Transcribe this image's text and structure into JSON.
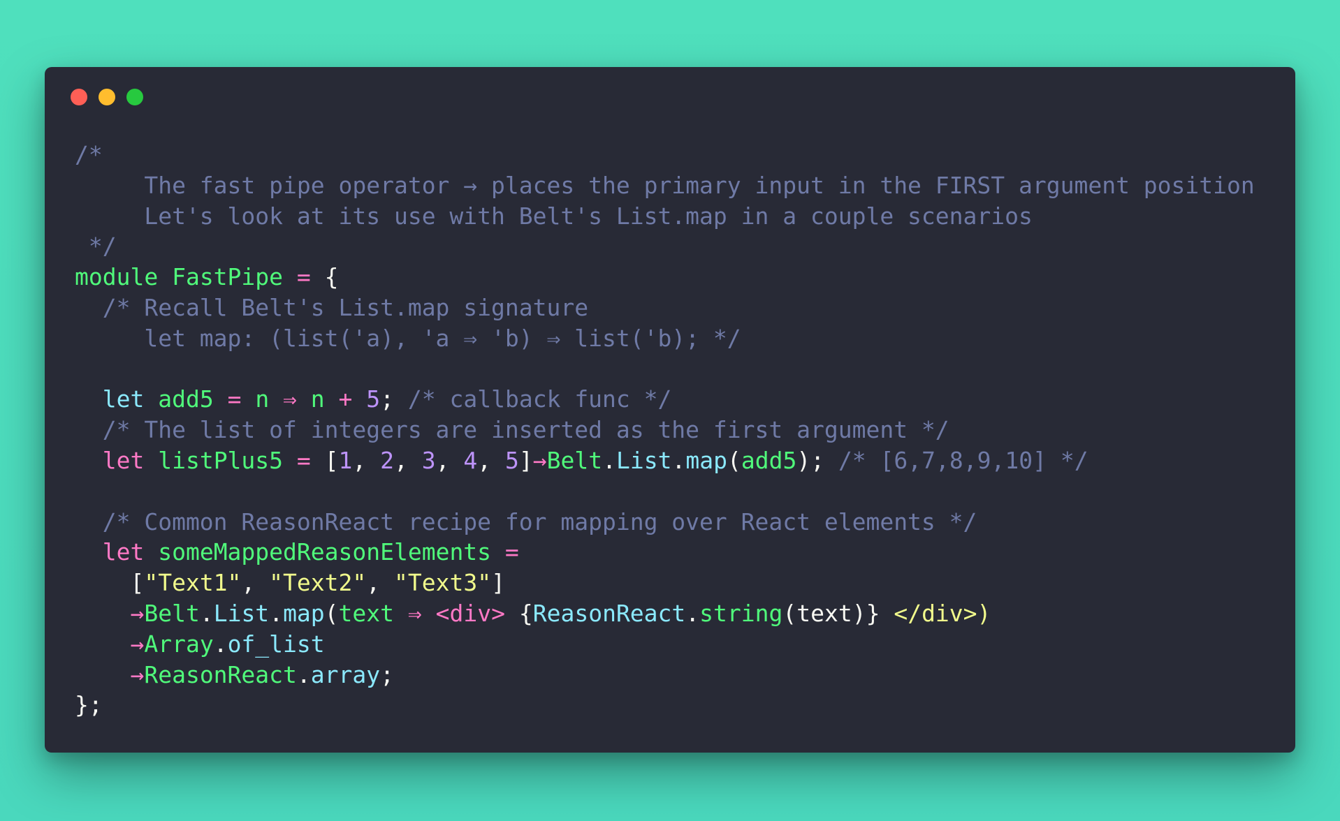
{
  "window": {
    "controls": {
      "close": "red-close",
      "minimize": "yellow-minimize",
      "zoom": "green-zoom"
    }
  },
  "code": {
    "lines": [
      [
        {
          "t": "/*",
          "c": "comment"
        }
      ],
      [
        {
          "t": "     The fast pipe operator → places the primary input in the FIRST argument position",
          "c": "comment"
        }
      ],
      [
        {
          "t": "     Let's look at its use with Belt's List.map in a couple scenarios",
          "c": "comment"
        }
      ],
      [
        {
          "t": " */",
          "c": "comment"
        }
      ],
      [
        {
          "t": "module ",
          "c": "module"
        },
        {
          "t": "FastPipe",
          "c": "name"
        },
        {
          "t": " = ",
          "c": "op"
        },
        {
          "t": "{",
          "c": "plain"
        }
      ],
      [
        {
          "t": "  /* Recall Belt's List.map signature",
          "c": "comment"
        }
      ],
      [
        {
          "t": "     let map: (list('a), 'a ⇒ 'b) ⇒ list('b); */",
          "c": "comment"
        }
      ],
      [],
      [
        {
          "t": "  let ",
          "c": "keyword-cyan"
        },
        {
          "t": "add5",
          "c": "ident"
        },
        {
          "t": " = ",
          "c": "op"
        },
        {
          "t": "n",
          "c": "ident"
        },
        {
          "t": " ⇒ ",
          "c": "op"
        },
        {
          "t": "n",
          "c": "ident"
        },
        {
          "t": " + ",
          "c": "op"
        },
        {
          "t": "5",
          "c": "number"
        },
        {
          "t": "; ",
          "c": "plain"
        },
        {
          "t": "/* callback func */",
          "c": "comment"
        }
      ],
      [
        {
          "t": "  /* The list of integers are inserted as the first argument */",
          "c": "comment"
        }
      ],
      [
        {
          "t": "  let ",
          "c": "keyword"
        },
        {
          "t": "listPlus5",
          "c": "ident"
        },
        {
          "t": " = ",
          "c": "op"
        },
        {
          "t": "[",
          "c": "plain"
        },
        {
          "t": "1",
          "c": "number"
        },
        {
          "t": ", ",
          "c": "plain"
        },
        {
          "t": "2",
          "c": "number"
        },
        {
          "t": ", ",
          "c": "plain"
        },
        {
          "t": "3",
          "c": "number"
        },
        {
          "t": ", ",
          "c": "plain"
        },
        {
          "t": "4",
          "c": "number"
        },
        {
          "t": ", ",
          "c": "plain"
        },
        {
          "t": "5",
          "c": "number"
        },
        {
          "t": "]",
          "c": "plain"
        },
        {
          "t": "→",
          "c": "op"
        },
        {
          "t": "Belt",
          "c": "ident"
        },
        {
          "t": ".",
          "c": "plain"
        },
        {
          "t": "List",
          "c": "func"
        },
        {
          "t": ".",
          "c": "plain"
        },
        {
          "t": "map",
          "c": "func"
        },
        {
          "t": "(",
          "c": "plain"
        },
        {
          "t": "add5",
          "c": "ident"
        },
        {
          "t": "); ",
          "c": "plain"
        },
        {
          "t": "/* [6,7,8,9,10] */",
          "c": "comment"
        }
      ],
      [],
      [
        {
          "t": "  /* Common ReasonReact recipe for mapping over React elements */",
          "c": "comment"
        }
      ],
      [
        {
          "t": "  let ",
          "c": "keyword"
        },
        {
          "t": "someMappedReasonElements",
          "c": "ident"
        },
        {
          "t": " =",
          "c": "op"
        }
      ],
      [
        {
          "t": "    [",
          "c": "plain"
        },
        {
          "t": "\"Text1\"",
          "c": "string"
        },
        {
          "t": ", ",
          "c": "plain"
        },
        {
          "t": "\"Text2\"",
          "c": "string"
        },
        {
          "t": ", ",
          "c": "plain"
        },
        {
          "t": "\"Text3\"",
          "c": "string"
        },
        {
          "t": "]",
          "c": "plain"
        }
      ],
      [
        {
          "t": "    →",
          "c": "op"
        },
        {
          "t": "Belt",
          "c": "ident"
        },
        {
          "t": ".",
          "c": "plain"
        },
        {
          "t": "List",
          "c": "func"
        },
        {
          "t": ".",
          "c": "plain"
        },
        {
          "t": "map",
          "c": "func"
        },
        {
          "t": "(",
          "c": "plain"
        },
        {
          "t": "text",
          "c": "ident"
        },
        {
          "t": " ⇒ ",
          "c": "op"
        },
        {
          "t": "<div>",
          "c": "tag"
        },
        {
          "t": " {",
          "c": "plain"
        },
        {
          "t": "ReasonReact",
          "c": "func"
        },
        {
          "t": ".",
          "c": "plain"
        },
        {
          "t": "string",
          "c": "ident"
        },
        {
          "t": "(text)} ",
          "c": "plain"
        },
        {
          "t": "</div>)",
          "c": "yellow"
        }
      ],
      [
        {
          "t": "    →",
          "c": "op"
        },
        {
          "t": "Array",
          "c": "ident"
        },
        {
          "t": ".",
          "c": "plain"
        },
        {
          "t": "of_list",
          "c": "func"
        }
      ],
      [
        {
          "t": "    →",
          "c": "op"
        },
        {
          "t": "ReasonReact",
          "c": "ident"
        },
        {
          "t": ".",
          "c": "plain"
        },
        {
          "t": "array",
          "c": "func"
        },
        {
          "t": ";",
          "c": "plain"
        }
      ],
      [
        {
          "t": "};",
          "c": "plain"
        }
      ]
    ]
  }
}
